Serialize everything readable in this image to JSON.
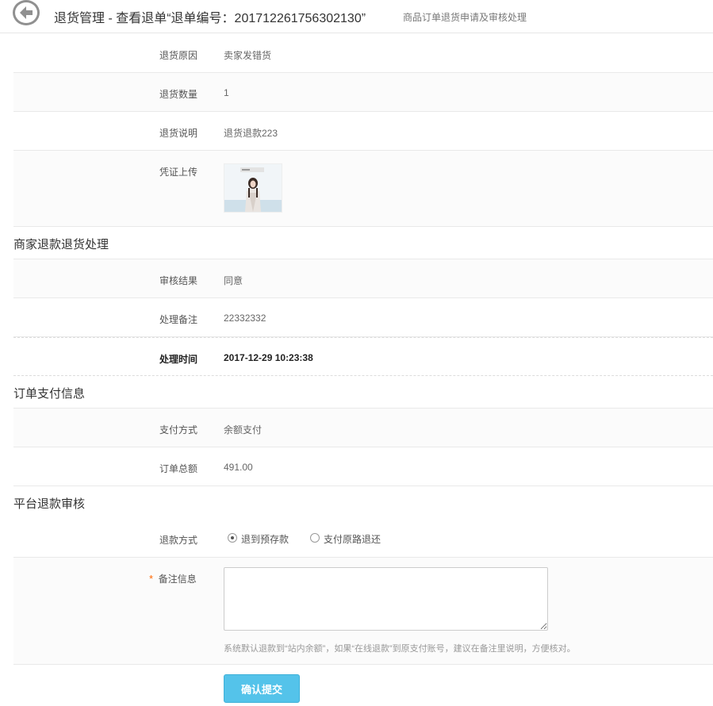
{
  "header": {
    "title": "退货管理 - 查看退单“退单编号：201712261756302130”",
    "subtitle": "商品订单退货申请及审核处理"
  },
  "return_info": {
    "reason_label": "退货原因",
    "reason": "卖家发错货",
    "qty_label": "退货数量",
    "qty": "1",
    "desc_label": "退货说明",
    "desc": "退货退款223",
    "proof_label": "凭证上传"
  },
  "merchant": {
    "section_title": "商家退款退货处理",
    "result_label": "审核结果",
    "result": "同意",
    "remark_label": "处理备注",
    "remark": "22332332",
    "time_label": "处理时间",
    "time": "2017-12-29 10:23:38"
  },
  "payment": {
    "section_title": "订单支付信息",
    "method_label": "支付方式",
    "method": "余额支付",
    "total_label": "订单总额",
    "total": "491.00"
  },
  "platform": {
    "section_title": "平台退款审核",
    "refund_method_label": "退款方式",
    "option_balance": "退到预存款",
    "option_original": "支付原路退还",
    "selected": "option_balance",
    "required_mark": "*",
    "note_label": "备注信息",
    "note_value": "",
    "hint": "系统默认退款到“站内余额”，如果“在线退款”到原支付账号，建议在备注里说明，方便核对。",
    "submit_label": "确认提交"
  }
}
